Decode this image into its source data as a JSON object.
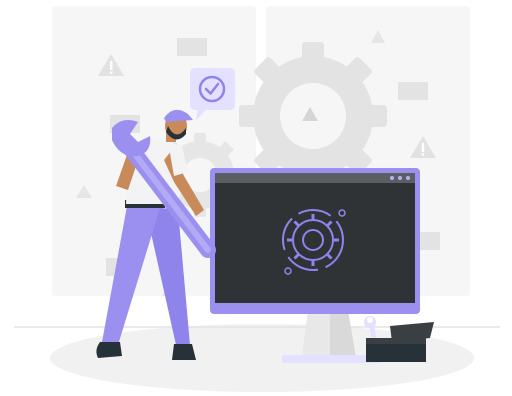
{
  "illustration": {
    "subject": "maintenance-worker-with-wrench-and-monitor",
    "icons": [
      "warning-icon",
      "check-icon",
      "gear-icon",
      "wrench-icon",
      "toolbox-icon"
    ],
    "colors": {
      "accent": "#9b8ff0",
      "accent_dark": "#6f63d8",
      "accent_light": "#e7e3ff",
      "screen": "#2f3336",
      "screen_header": "#3a3f43",
      "bg_gray": "#eeeeee",
      "mid_gray": "#d8d8d8",
      "skin": "#c98a5b",
      "shirt": "#f3f3f5",
      "dark": "#263238"
    }
  }
}
